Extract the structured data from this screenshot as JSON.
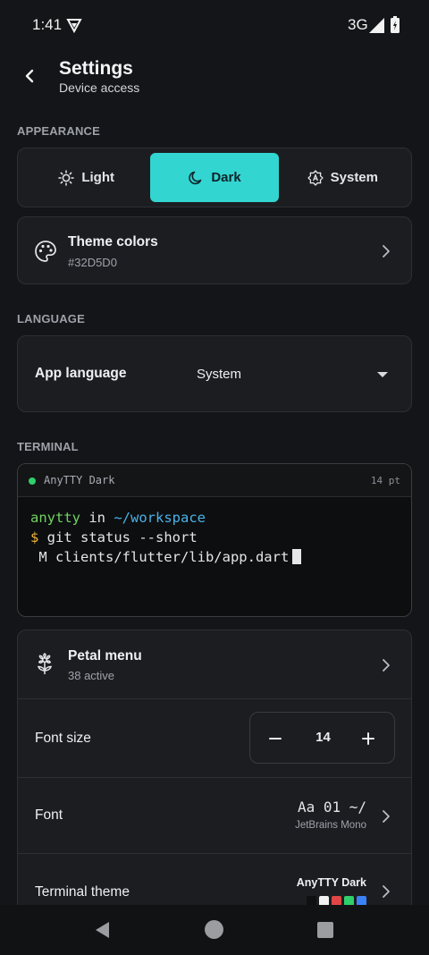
{
  "status_bar": {
    "time": "1:41",
    "network": "3G",
    "icons": [
      "vpn-icon",
      "signal-icon",
      "battery-charging-icon"
    ]
  },
  "header": {
    "title": "Settings",
    "subtitle": "Device access"
  },
  "appearance": {
    "section_label": "APPEARANCE",
    "options": [
      {
        "label": "Light",
        "icon": "sun-icon"
      },
      {
        "label": "Dark",
        "icon": "moon-icon"
      },
      {
        "label": "System",
        "icon": "auto-icon"
      }
    ],
    "selected": "Dark",
    "accent_color": "#32D5D0",
    "theme_colors": {
      "title": "Theme colors",
      "value": "#32D5D0"
    }
  },
  "language": {
    "section_label": "LANGUAGE",
    "label": "App language",
    "value": "System"
  },
  "terminal": {
    "section_label": "TERMINAL",
    "preview": {
      "theme_name": "AnyTTY Dark",
      "size": "14 pt",
      "line1_user": "anytty",
      "line1_in": " in ",
      "line1_path": "~/workspace",
      "line2_prompt": "$",
      "line2_cmd": " git status --short",
      "line3": " M clients/flutter/lib/app.dart"
    }
  },
  "terminal_settings": {
    "petal_menu": {
      "title": "Petal menu",
      "subtitle": "38 active"
    },
    "font_size": {
      "label": "Font size",
      "value": "14"
    },
    "font": {
      "label": "Font",
      "preview": "Aa 01 ~/",
      "name": "JetBrains Mono"
    },
    "terminal_theme": {
      "label": "Terminal theme",
      "value": "AnyTTY Dark",
      "swatches": [
        "#0f1012",
        "#f2f2f2",
        "#e04646",
        "#2fcf6b",
        "#3b82f6"
      ]
    }
  }
}
